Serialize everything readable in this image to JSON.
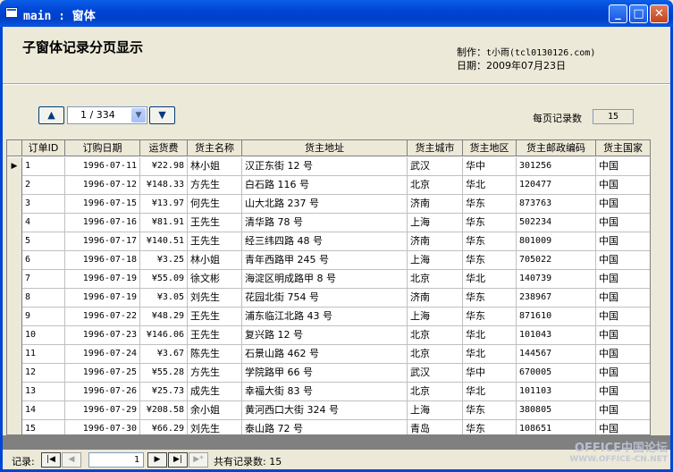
{
  "window": {
    "title": "main : 窗体"
  },
  "header": {
    "title": "子窗体记录分页显示",
    "author_label": "制作：",
    "author_value": "t小雨(tcl0130126.com)",
    "date_label": "日期：",
    "date_value": "2009年07月23日"
  },
  "pager": {
    "current": "1 / 334",
    "per_page_label": "每页记录数",
    "per_page_value": "15"
  },
  "grid": {
    "columns": [
      "订单ID",
      "订购日期",
      "运货费",
      "货主名称",
      "货主地址",
      "货主城市",
      "货主地区",
      "货主邮政编码",
      "货主国家"
    ],
    "rows": [
      [
        "1",
        "1996-07-11",
        "¥22.98",
        "林小姐",
        "汉正东街 12 号",
        "武汉",
        "华中",
        "301256",
        "中国"
      ],
      [
        "2",
        "1996-07-12",
        "¥148.33",
        "方先生",
        "白石路 116 号",
        "北京",
        "华北",
        "120477",
        "中国"
      ],
      [
        "3",
        "1996-07-15",
        "¥13.97",
        "何先生",
        "山大北路 237 号",
        "济南",
        "华东",
        "873763",
        "中国"
      ],
      [
        "4",
        "1996-07-16",
        "¥81.91",
        "王先生",
        "清华路 78 号",
        "上海",
        "华东",
        "502234",
        "中国"
      ],
      [
        "5",
        "1996-07-17",
        "¥140.51",
        "王先生",
        "经三纬四路 48 号",
        "济南",
        "华东",
        "801009",
        "中国"
      ],
      [
        "6",
        "1996-07-18",
        "¥3.25",
        "林小姐",
        "青年西路甲 245 号",
        "上海",
        "华东",
        "705022",
        "中国"
      ],
      [
        "7",
        "1996-07-19",
        "¥55.09",
        "徐文彬",
        "海淀区明成路甲 8 号",
        "北京",
        "华北",
        "140739",
        "中国"
      ],
      [
        "8",
        "1996-07-19",
        "¥3.05",
        "刘先生",
        "花园北街 754 号",
        "济南",
        "华东",
        "238967",
        "中国"
      ],
      [
        "9",
        "1996-07-22",
        "¥48.29",
        "王先生",
        "浦东临江北路 43 号",
        "上海",
        "华东",
        "871610",
        "中国"
      ],
      [
        "10",
        "1996-07-23",
        "¥146.06",
        "王先生",
        "复兴路 12 号",
        "北京",
        "华北",
        "101043",
        "中国"
      ],
      [
        "11",
        "1996-07-24",
        "¥3.67",
        "陈先生",
        "石景山路 462 号",
        "北京",
        "华北",
        "144567",
        "中国"
      ],
      [
        "12",
        "1996-07-25",
        "¥55.28",
        "方先生",
        "学院路甲 66 号",
        "武汉",
        "华中",
        "670005",
        "中国"
      ],
      [
        "13",
        "1996-07-26",
        "¥25.73",
        "成先生",
        "幸福大街 83 号",
        "北京",
        "华北",
        "101103",
        "中国"
      ],
      [
        "14",
        "1996-07-29",
        "¥208.58",
        "余小姐",
        "黄河西口大街 324 号",
        "上海",
        "华东",
        "380805",
        "中国"
      ],
      [
        "15",
        "1996-07-30",
        "¥66.29",
        "刘先生",
        "泰山路 72 号",
        "青岛",
        "华东",
        "108651",
        "中国"
      ]
    ]
  },
  "recordbar": {
    "label": "记录:",
    "current": "1",
    "total_text": "共有记录数: 15"
  },
  "watermark": {
    "line1": "OFFICE中国论坛",
    "line2": "WWW.OFFICE-CN.NET"
  }
}
